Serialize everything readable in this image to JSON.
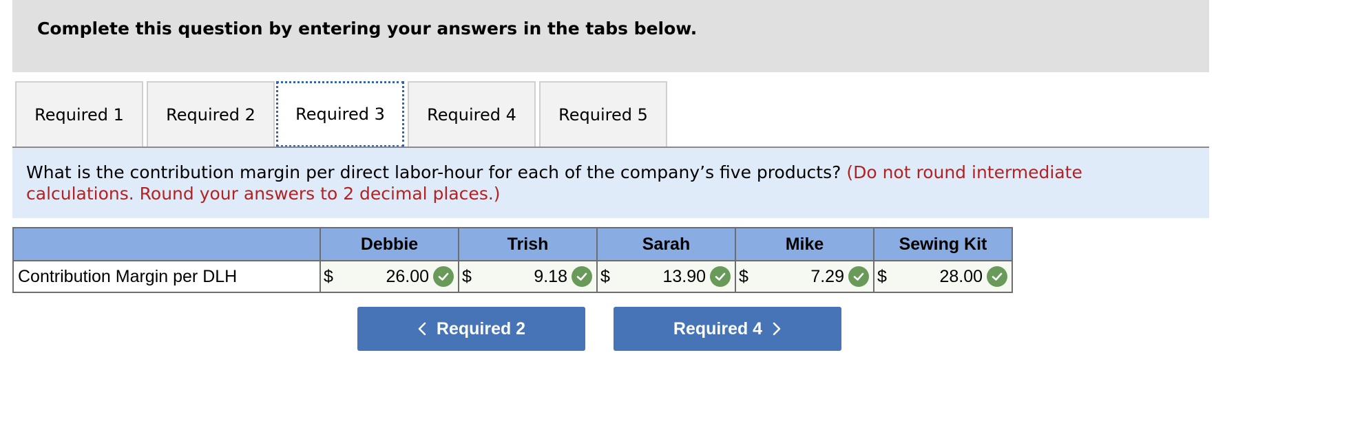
{
  "header": {
    "instruction": "Complete this question by entering your answers in the tabs below."
  },
  "tabs": [
    {
      "label": "Required 1"
    },
    {
      "label": "Required 2"
    },
    {
      "label": "Required 3"
    },
    {
      "label": "Required 4"
    },
    {
      "label": "Required 5"
    }
  ],
  "active_tab": "Required 3",
  "question": {
    "text": "What is the contribution margin per direct labor-hour for each of the company’s five products?",
    "note": "(Do not round intermediate calculations. Round your answers to 2 decimal places.)"
  },
  "table": {
    "columns": [
      "Debbie",
      "Trish",
      "Sarah",
      "Mike",
      "Sewing Kit"
    ],
    "row_label": "Contribution Margin per DLH",
    "currency": "$",
    "values": [
      "26.00",
      "9.18",
      "13.90",
      "7.29",
      "28.00"
    ]
  },
  "nav": {
    "prev_label": "Required 2",
    "next_label": "Required 4"
  },
  "colors": {
    "header_bg": "#e0e0e0",
    "question_bg": "#dfebf8",
    "note_red": "#b22222",
    "table_header_bg": "#89ade3",
    "button_blue": "#4674b7",
    "check_green": "#6a9a5a"
  }
}
